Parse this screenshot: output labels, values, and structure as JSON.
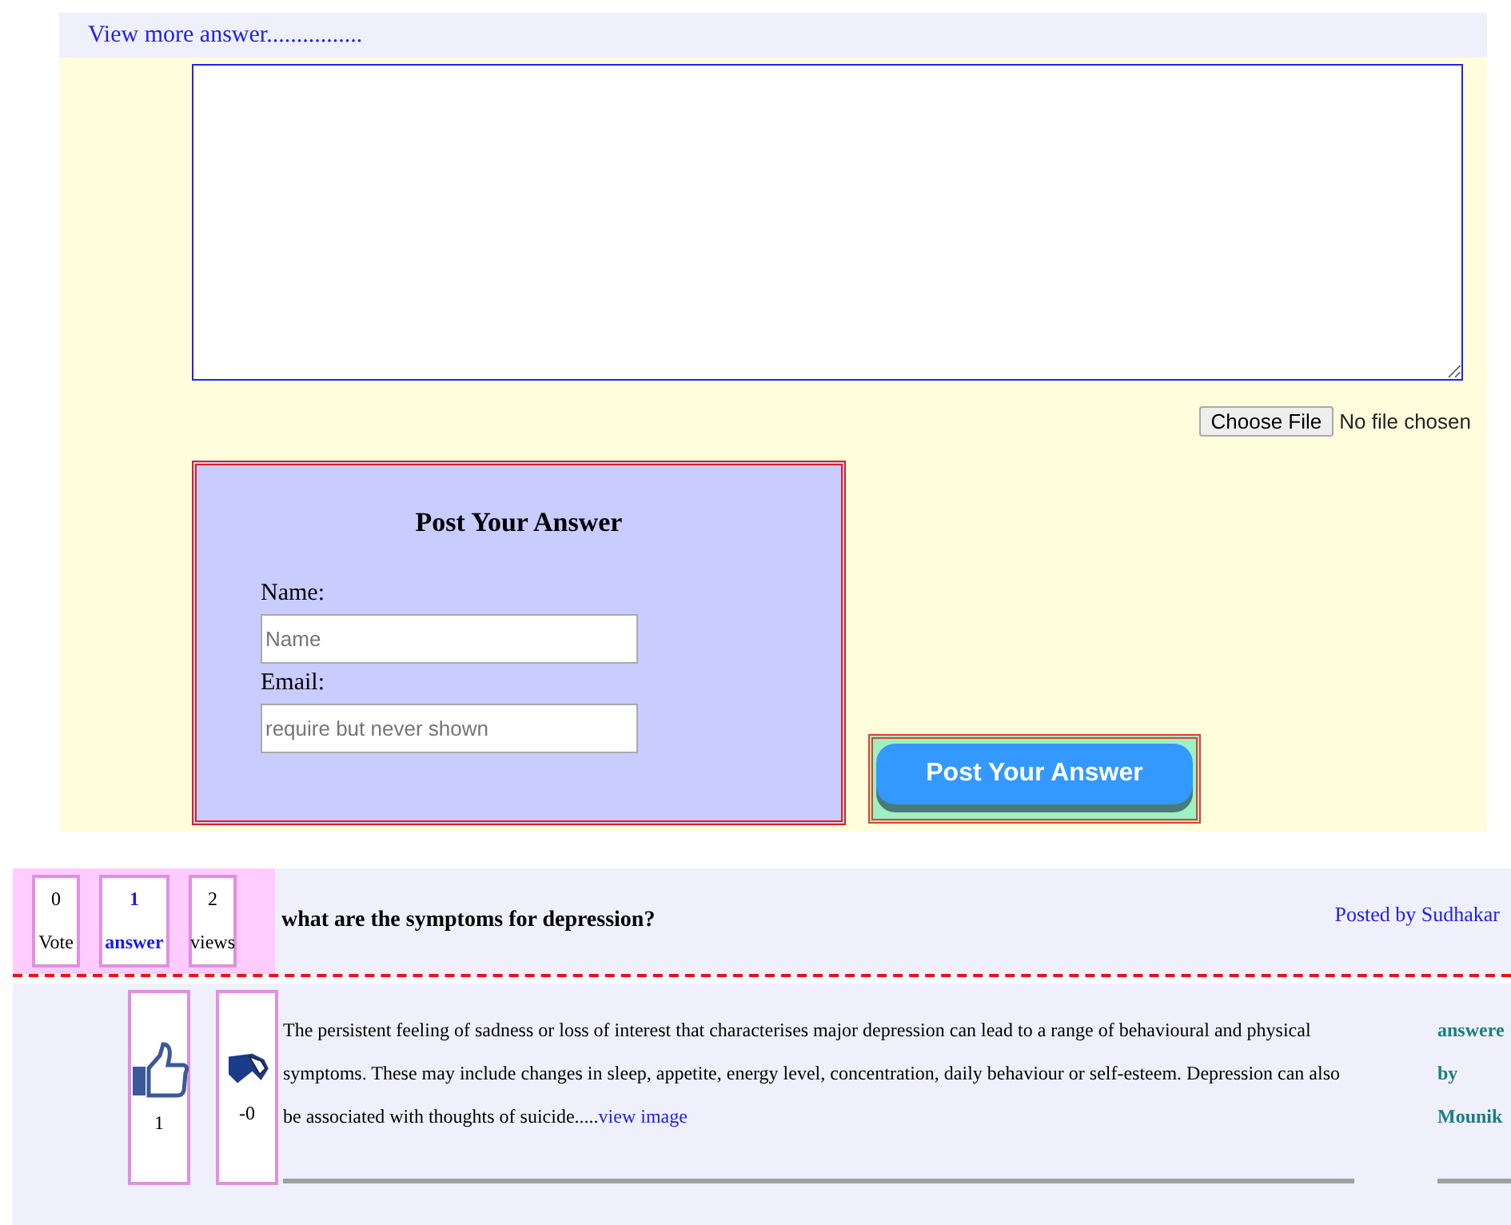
{
  "view_more_link": "View more answer................",
  "file_input": {
    "button": "Choose File",
    "status": "No file chosen"
  },
  "answer_form": {
    "title": "Post Your Answer",
    "fields": [
      {
        "label": "Name:",
        "placeholder": "Name"
      },
      {
        "label": "Email:",
        "placeholder": "require but never shown"
      }
    ]
  },
  "submit_button": "Post Your Answer",
  "question": {
    "stats": [
      {
        "count": "0",
        "label": "Vote",
        "kind": "plain"
      },
      {
        "count": "1",
        "label": "answer",
        "kind": "highlight"
      },
      {
        "count": "2",
        "label": "views",
        "kind": "plain"
      }
    ],
    "title": "what are the symptoms for depression?",
    "posted_by": "Posted by Sudhakar"
  },
  "answer": {
    "likes": "1",
    "dislikes": "-0",
    "text": "The persistent feeling of sadness or loss of interest that characterises major depression can lead to a range of behavioural and physical symptoms. These may include changes in sleep, appetite, energy level, concentration, daily behaviour or self-esteem. Depression can also be associated with thoughts of suicide.....",
    "image_link": "view image",
    "author_lines": [
      "answere",
      "by",
      "Mounik"
    ]
  }
}
